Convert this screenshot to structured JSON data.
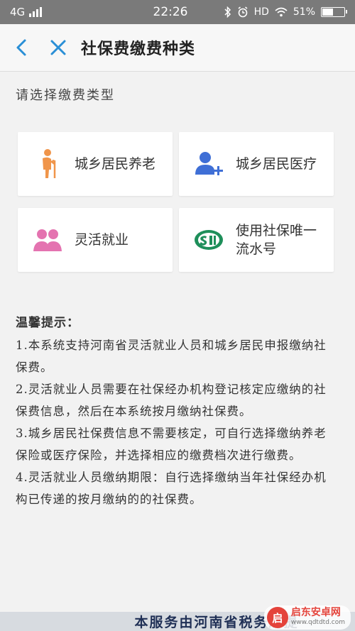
{
  "status_bar": {
    "network": "4G",
    "time": "22:26",
    "hd": "HD",
    "battery_text": "51%",
    "battery_level": 0.51
  },
  "header": {
    "title": "社保费缴费种类"
  },
  "section_title": "请选择缴费类型",
  "cards": [
    {
      "label": "城乡居民养老",
      "icon": "elderly-person-icon",
      "color": "#f0954a"
    },
    {
      "label": "城乡居民医疗",
      "icon": "add-user-icon",
      "color": "#3f6fd6"
    },
    {
      "label": "灵活就业",
      "icon": "group-people-icon",
      "color": "#e473b0"
    },
    {
      "label": "使用社保唯一流水号",
      "label_line1": "使用社保唯一",
      "label_line2": "流水号",
      "icon": "social-insurance-logo-icon",
      "color": "#1e8f5a"
    }
  ],
  "tips": {
    "title": "温馨提示：",
    "items": [
      "1.本系统支持河南省灵活就业人员和城乡居民申报缴纳社保费。",
      "2.灵活就业人员需要在社保经办机构登记核定应缴纳的社保费信息，然后在本系统按月缴纳社保费。",
      "3.城乡居民社保费信息不需要核定，可自行选择缴纳养老保险或医疗保险，并选择相应的缴费档次进行缴费。",
      "4.灵活就业人员缴纳期限：自行选择缴纳当年社保经办机构已传递的按月缴纳的的社保费。"
    ]
  },
  "footer": {
    "text": "本服务由河南省税务局提"
  },
  "watermark": {
    "logo": "启",
    "name": "启东安卓网",
    "url": "www.qdtdtd.com"
  }
}
